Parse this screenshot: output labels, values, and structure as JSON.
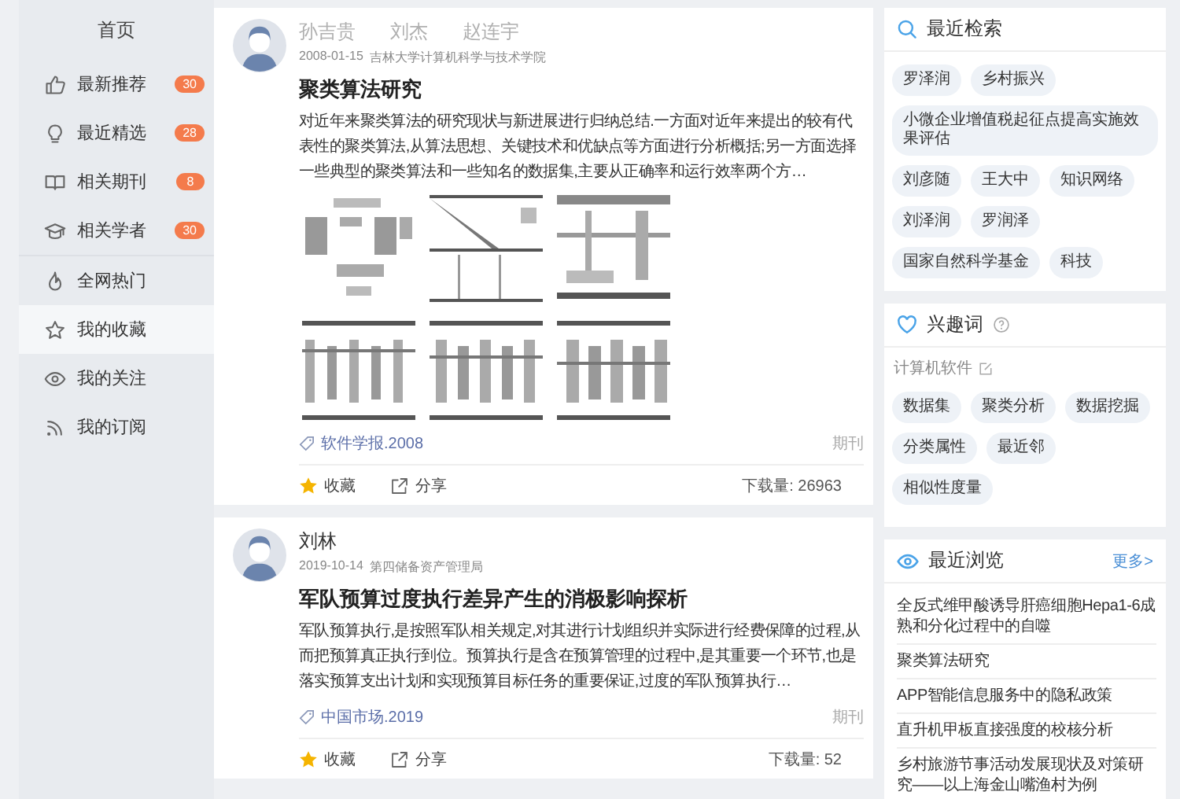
{
  "sidebar": {
    "header": "首页",
    "items": [
      {
        "label": "最新推荐",
        "badge": "30",
        "selected": false
      },
      {
        "label": "最近精选",
        "badge": "28",
        "selected": false
      },
      {
        "label": "相关期刊",
        "badge": "8",
        "selected": false
      },
      {
        "label": "相关学者",
        "badge": "30",
        "selected": false
      },
      {
        "label": "全网热门",
        "selected": false
      },
      {
        "label": "我的收藏",
        "selected": true
      },
      {
        "label": "我的关注",
        "selected": false
      },
      {
        "label": "我的订阅",
        "selected": false
      }
    ]
  },
  "papers": [
    {
      "authors": [
        "孙吉贵",
        "刘杰",
        "赵连宇"
      ],
      "authors_dimmed": true,
      "date": "2008-01-15",
      "org": "吉林大学计算机科学与技术学院",
      "title": "聚类算法研究",
      "abstract": "对近年来聚类算法的研究现状与新进展进行归纳总结.一方面对近年来提出的较有代表性的聚类算法,从算法思想、关键技术和优缺点等方面进行分析概括;另一方面选择一些典型的聚类算法和一些知名的数据集,主要从正确率和运行效率两个方…",
      "source": "软件学报.2008",
      "type": "期刊",
      "favorite": "收藏",
      "share": "分享",
      "downloads": "下载量: 26963"
    },
    {
      "authors": [
        "刘林"
      ],
      "authors_dimmed": false,
      "date": "2019-10-14",
      "org": "第四储备资产管理局",
      "title": "军队预算过度执行差异产生的消极影响探析",
      "abstract": "军队预算执行,是按照军队相关规定,对其进行计划组织并实际进行经费保障的过程,从而把预算真正执行到位。预算执行是含在预算管理的过程中,是其重要一个环节,也是落实预算支出计划和实现预算目标任务的重要保证,过度的军队预算执行…",
      "source": "中国市场.2019",
      "type": "期刊",
      "favorite": "收藏",
      "share": "分享",
      "downloads": "下载量: 52"
    }
  ],
  "recent_searches": {
    "title": "最近检索",
    "chips": [
      "罗泽润",
      "乡村振兴",
      "小微企业增值税起征点提高实施效果评估",
      "刘彦随",
      "王大中",
      "知识网络",
      "刘泽润",
      "罗润泽",
      "国家自然科学基金",
      "科技"
    ]
  },
  "interests": {
    "title": "兴趣词",
    "category": "计算机软件",
    "chips": [
      "数据集",
      "聚类分析",
      "数据挖掘",
      "分类属性",
      "最近邻",
      "相似性度量"
    ]
  },
  "recent_views": {
    "title": "最近浏览",
    "more": "更多>",
    "items": [
      "全反式维甲酸诱导肝癌细胞Hepa1-6成熟和分化过程中的自噬",
      "聚类算法研究",
      "APP智能信息服务中的隐私政策",
      "直升机甲板直接强度的校核分析",
      "乡村旅游节事活动发展现状及对策研究——以上海金山嘴渔村为例"
    ]
  }
}
